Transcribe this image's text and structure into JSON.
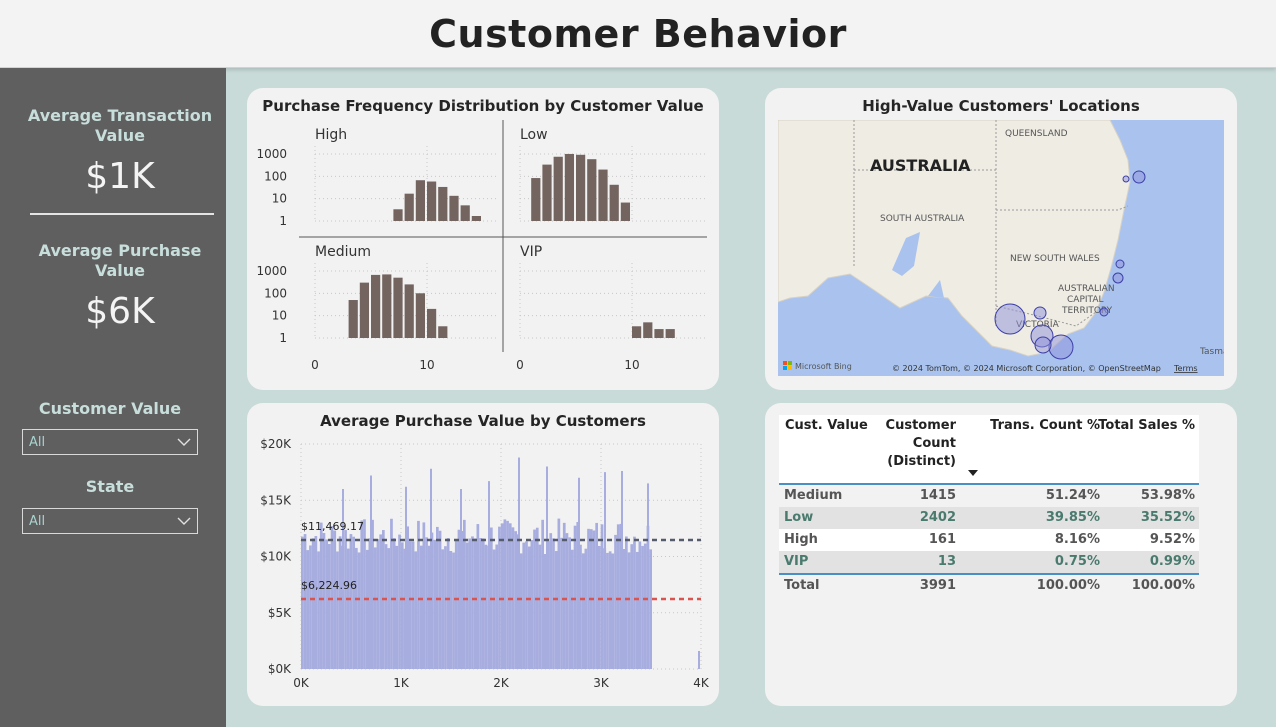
{
  "header": {
    "title": "Customer Behavior"
  },
  "sidebar": {
    "kpis": [
      {
        "title": "Average Transaction Value",
        "value": "$1K"
      },
      {
        "title": "Average Purchase Value",
        "value": "$6K"
      }
    ],
    "slicers": [
      {
        "title": "Customer Value",
        "selected": "All"
      },
      {
        "title": "State",
        "selected": "All"
      }
    ]
  },
  "colors": {
    "background": "#c9dbd9",
    "sidebar": "#5f5f5f",
    "bar_brown": "#736460",
    "bar_lavender": "#a7addf",
    "ref_dark": "#555b6b",
    "ref_red": "#d9534f",
    "map_water": "#a9c3ee",
    "map_land": "#efece4",
    "bubble": "#8d8fd9",
    "table_accent": "#4a8fc4",
    "green_text": "#4a7a6e"
  },
  "freq_chart": {
    "title": "Purchase Frequency Distribution by Customer Value",
    "y_ticks": [
      "1000",
      "100",
      "10",
      "1"
    ],
    "x_ticks": [
      "0",
      "10"
    ],
    "panels": [
      {
        "label": "High",
        "start": 7,
        "counts": [
          2,
          10,
          40,
          35,
          20,
          8,
          3,
          1
        ]
      },
      {
        "label": "Low",
        "start": 1,
        "counts": [
          50,
          200,
          450,
          600,
          550,
          350,
          120,
          25,
          4
        ]
      },
      {
        "label": "Medium",
        "start": 3,
        "counts": [
          30,
          180,
          400,
          420,
          300,
          150,
          60,
          12,
          2
        ]
      },
      {
        "label": "VIP",
        "start": 10,
        "counts": [
          2,
          3,
          1.5,
          1.5
        ]
      }
    ]
  },
  "map": {
    "title": "High-Value Customers' Locations",
    "labels": {
      "country": "AUSTRALIA",
      "qld": "QUEENSLAND",
      "sa": "SOUTH AUSTRALIA",
      "nsw": "NEW SOUTH WALES",
      "act1": "AUSTRALIAN",
      "act2": "CAPITAL",
      "act3": "TERRITORY",
      "vic": "VICTORIA",
      "tas": "Tasma"
    },
    "attribution": "© 2024 TomTom, © 2024 Microsoft Corporation, © OpenStreetMap",
    "terms": "Terms",
    "bing": "Microsoft Bing"
  },
  "purchase_chart": {
    "title": "Average Purchase Value by Customers",
    "y_ticks": [
      "$20K",
      "$15K",
      "$10K",
      "$5K",
      "$0K"
    ],
    "x_ticks": [
      "0K",
      "1K",
      "2K",
      "3K",
      "4K"
    ],
    "ref_upper_label": "$11,469.17",
    "ref_lower_label": "$6,224.96"
  },
  "chart_data": {
    "type": "bar",
    "title": "Average Purchase Value by Customers",
    "xlabel": "",
    "ylabel": "",
    "xlim": [
      0,
      4000
    ],
    "ylim": [
      0,
      20000
    ],
    "customer_count": 3510,
    "reference_lines": [
      {
        "label": "$11,469.17",
        "value": 11469.17
      },
      {
        "label": "$6,224.96",
        "value": 6224.96
      }
    ],
    "outliers": [
      {
        "x": 2180,
        "y": 18800
      },
      {
        "x": 2460,
        "y": 18000
      },
      {
        "x": 1300,
        "y": 17800
      },
      {
        "x": 3040,
        "y": 17500
      },
      {
        "x": 3210,
        "y": 17600
      },
      {
        "x": 700,
        "y": 17200
      },
      {
        "x": 1880,
        "y": 16700
      },
      {
        "x": 2780,
        "y": 17000
      },
      {
        "x": 1050,
        "y": 16200
      },
      {
        "x": 420,
        "y": 16000
      },
      {
        "x": 3470,
        "y": 16500
      },
      {
        "x": 1600,
        "y": 16000
      },
      {
        "x": 3980,
        "y": 1600
      }
    ]
  },
  "table": {
    "headers": {
      "cust_value": "Cust. Value",
      "count1": "Customer",
      "count2": "Count",
      "count3": "(Distinct)",
      "trans": "Trans. Count %",
      "sales": "Total Sales %"
    },
    "rows": [
      {
        "name": "Medium",
        "count": "1415",
        "trans": "51.24%",
        "sales": "53.98%"
      },
      {
        "name": "Low",
        "count": "2402",
        "trans": "39.85%",
        "sales": "35.52%"
      },
      {
        "name": "High",
        "count": "161",
        "trans": "8.16%",
        "sales": "9.52%"
      },
      {
        "name": "VIP",
        "count": "13",
        "trans": "0.75%",
        "sales": "0.99%"
      }
    ],
    "total": {
      "name": "Total",
      "count": "3991",
      "trans": "100.00%",
      "sales": "100.00%"
    }
  }
}
